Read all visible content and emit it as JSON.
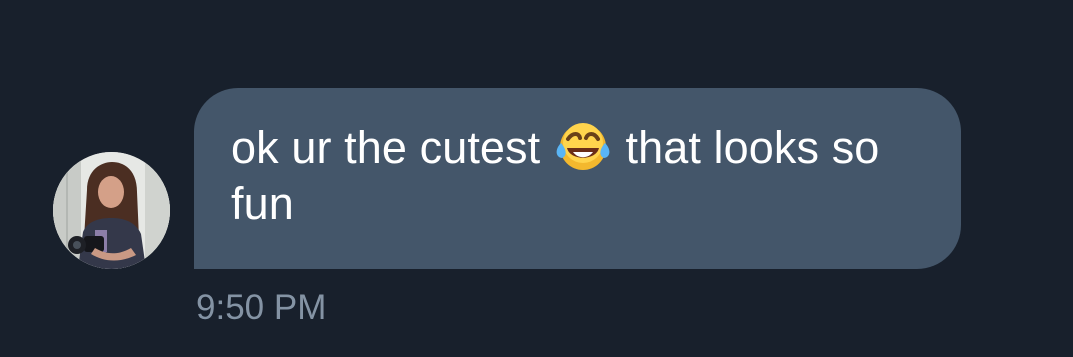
{
  "conversation": {
    "message": {
      "text_before_emoji": "ok ur the cutest ",
      "emoji": "face-with-tears-of-joy-icon",
      "text_after_emoji": " that looks so fun",
      "timestamp": "9:50 PM"
    },
    "sender": {
      "avatar": "profile-photo"
    }
  },
  "colors": {
    "background": "#18202c",
    "bubble": "#44566a",
    "message_text": "#ffffff",
    "timestamp_text": "#8493a4"
  }
}
